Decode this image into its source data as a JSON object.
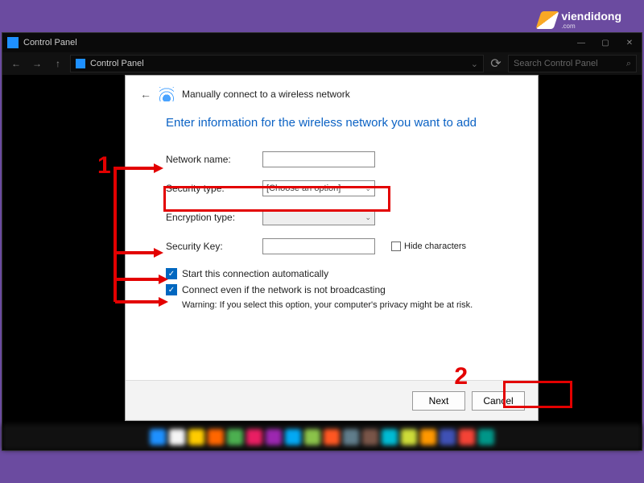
{
  "watermark": {
    "brand": "viendidong",
    "sub": ".com"
  },
  "window": {
    "title": "Control Panel",
    "controls": {
      "min": "—",
      "max": "▢",
      "close": "✕"
    }
  },
  "nav": {
    "back": "←",
    "fwd": "→",
    "up": "↑",
    "breadcrumb": "Control Panel",
    "dropdown_chev": "⌄",
    "refresh": "⟳",
    "search_placeholder": "Search Control Panel"
  },
  "wizard": {
    "back_arrow": "←",
    "title": "Manually connect to a wireless network",
    "heading": "Enter information for the wireless network you want to add",
    "fields": {
      "network_name": {
        "label": "Network name:",
        "value": ""
      },
      "security_type": {
        "label": "Security type:",
        "value": "[Choose an option]"
      },
      "encryption_type": {
        "label": "Encryption type:",
        "value": ""
      },
      "security_key": {
        "label": "Security Key:",
        "value": ""
      }
    },
    "hide_characters": {
      "label": "Hide characters",
      "checked": false
    },
    "auto_connect": {
      "label": "Start this connection automatically",
      "checked": true
    },
    "connect_hidden": {
      "label": "Connect even if the network is not broadcasting",
      "checked": true
    },
    "warning": "Warning: If you select this option, your computer's privacy might be at risk.",
    "buttons": {
      "next": "Next",
      "cancel": "Cancel"
    }
  },
  "annotations": {
    "num1": "1",
    "num2": "2"
  },
  "checkmark": "✓",
  "search_glyph": "⌕",
  "taskbar_colors": [
    "#1e90ff",
    "#f5f5f5",
    "#ffcc00",
    "#ff6600",
    "#4caf50",
    "#e91e63",
    "#9c27b0",
    "#03a9f4",
    "#8bc34a",
    "#ff5722",
    "#607d8b",
    "#795548",
    "#00bcd4",
    "#cddc39",
    "#ff9800",
    "#3f51b5",
    "#f44336",
    "#009688"
  ]
}
